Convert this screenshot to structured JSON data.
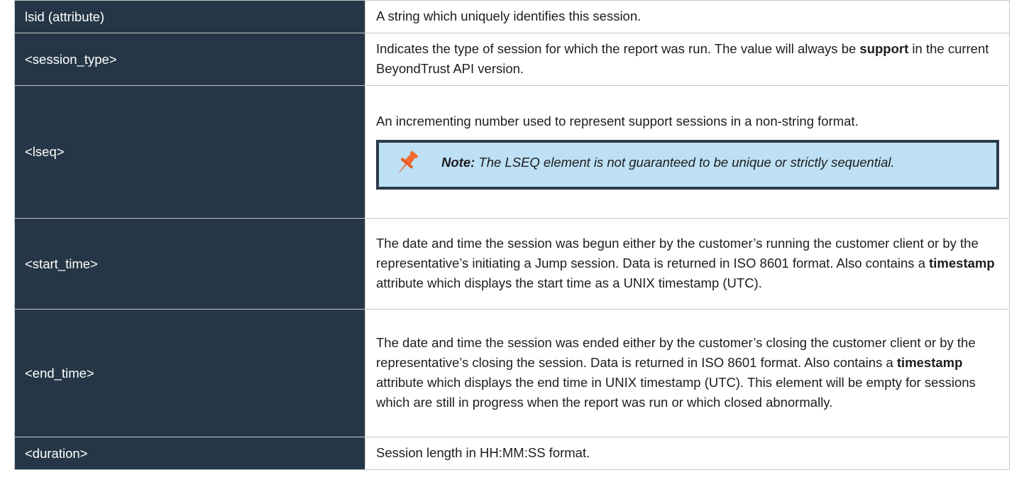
{
  "rows": [
    {
      "key": "lsid (attribute)",
      "desc": "A string which uniquely identifies this session."
    },
    {
      "key": "<session_type>",
      "desc_pre": "Indicates the type of session for which the report was run. The value will always be ",
      "desc_bold": "support",
      "desc_post": " in the current BeyondTrust API version."
    },
    {
      "key": "<lseq>",
      "desc": "An incrementing number used to represent support sessions in a non-string format.",
      "note": {
        "label": "Note:",
        "text": " The LSEQ element is not guaranteed to be unique or strictly sequential.",
        "icon": "pushpin-icon"
      }
    },
    {
      "key": "<start_time>",
      "desc_pre": "The date and time the session was begun either by the customer’s running the customer client or by the representative’s initiating a Jump session. Data is returned in ISO 8601 format. Also contains a ",
      "desc_bold": "timestamp",
      "desc_post": " attribute which displays the start time as a UNIX timestamp (UTC)."
    },
    {
      "key": "<end_time>",
      "desc_pre": "The date and time the session was ended either by the customer’s closing the customer client or by the representative’s closing the session. Data is returned in ISO 8601 format. Also contains a ",
      "desc_bold": "timestamp",
      "desc_post": " attribute which displays the end time in UNIX timestamp (UTC). This element will be empty for sessions which are still in progress when the report was run or which closed abnormally."
    },
    {
      "key": "<duration>",
      "desc": "Session length in HH:MM:SS format."
    }
  ],
  "colors": {
    "key_bg": "#253746",
    "note_bg": "#bde0f5",
    "note_border": "#2b3b49",
    "pin": "#f26a2e"
  }
}
